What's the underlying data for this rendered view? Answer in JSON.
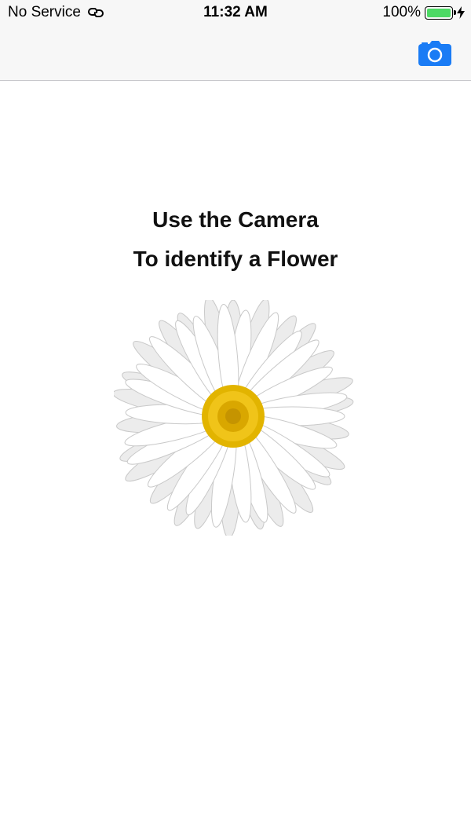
{
  "status_bar": {
    "carrier": "No Service",
    "time": "11:32 AM",
    "battery_percent": "100%",
    "battery_level": 1.0,
    "battery_color": "#4cd964",
    "icons": [
      "link-icon",
      "battery-icon",
      "charging-bolt-icon"
    ]
  },
  "nav_bar": {
    "camera_icon": "camera-icon",
    "accent_color": "#1a7cf5"
  },
  "main": {
    "line1": "Use the Camera",
    "line2": "To identify a Flower",
    "image": "daisy-flower-image"
  }
}
